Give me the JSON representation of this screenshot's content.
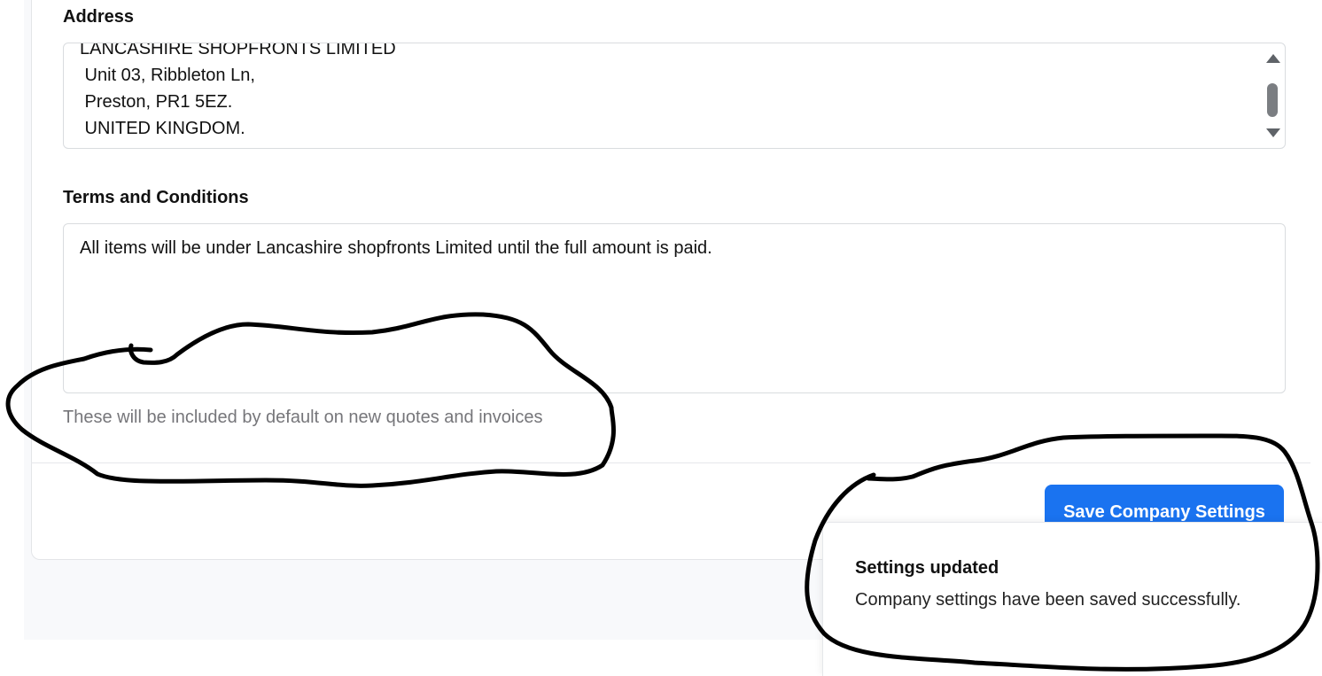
{
  "address": {
    "label": "Address",
    "lines": "LANCASHIRE SHOPFRONTS LIMITED\n Unit 03, Ribbleton Ln,\n Preston, PR1 5EZ.\n UNITED KINGDOM."
  },
  "terms": {
    "label": "Terms and Conditions",
    "value": "All items will be under Lancashire shopfronts Limited until the full amount is paid.",
    "helper": "These will be included by default on new quotes and invoices"
  },
  "actions": {
    "save_label": "Save Company Settings"
  },
  "toast": {
    "title": "Settings updated",
    "message": "Company settings have been saved successfully."
  },
  "colors": {
    "primary": "#1a73f0",
    "helper_text": "#76767a",
    "annotation_ink": "#000000"
  }
}
